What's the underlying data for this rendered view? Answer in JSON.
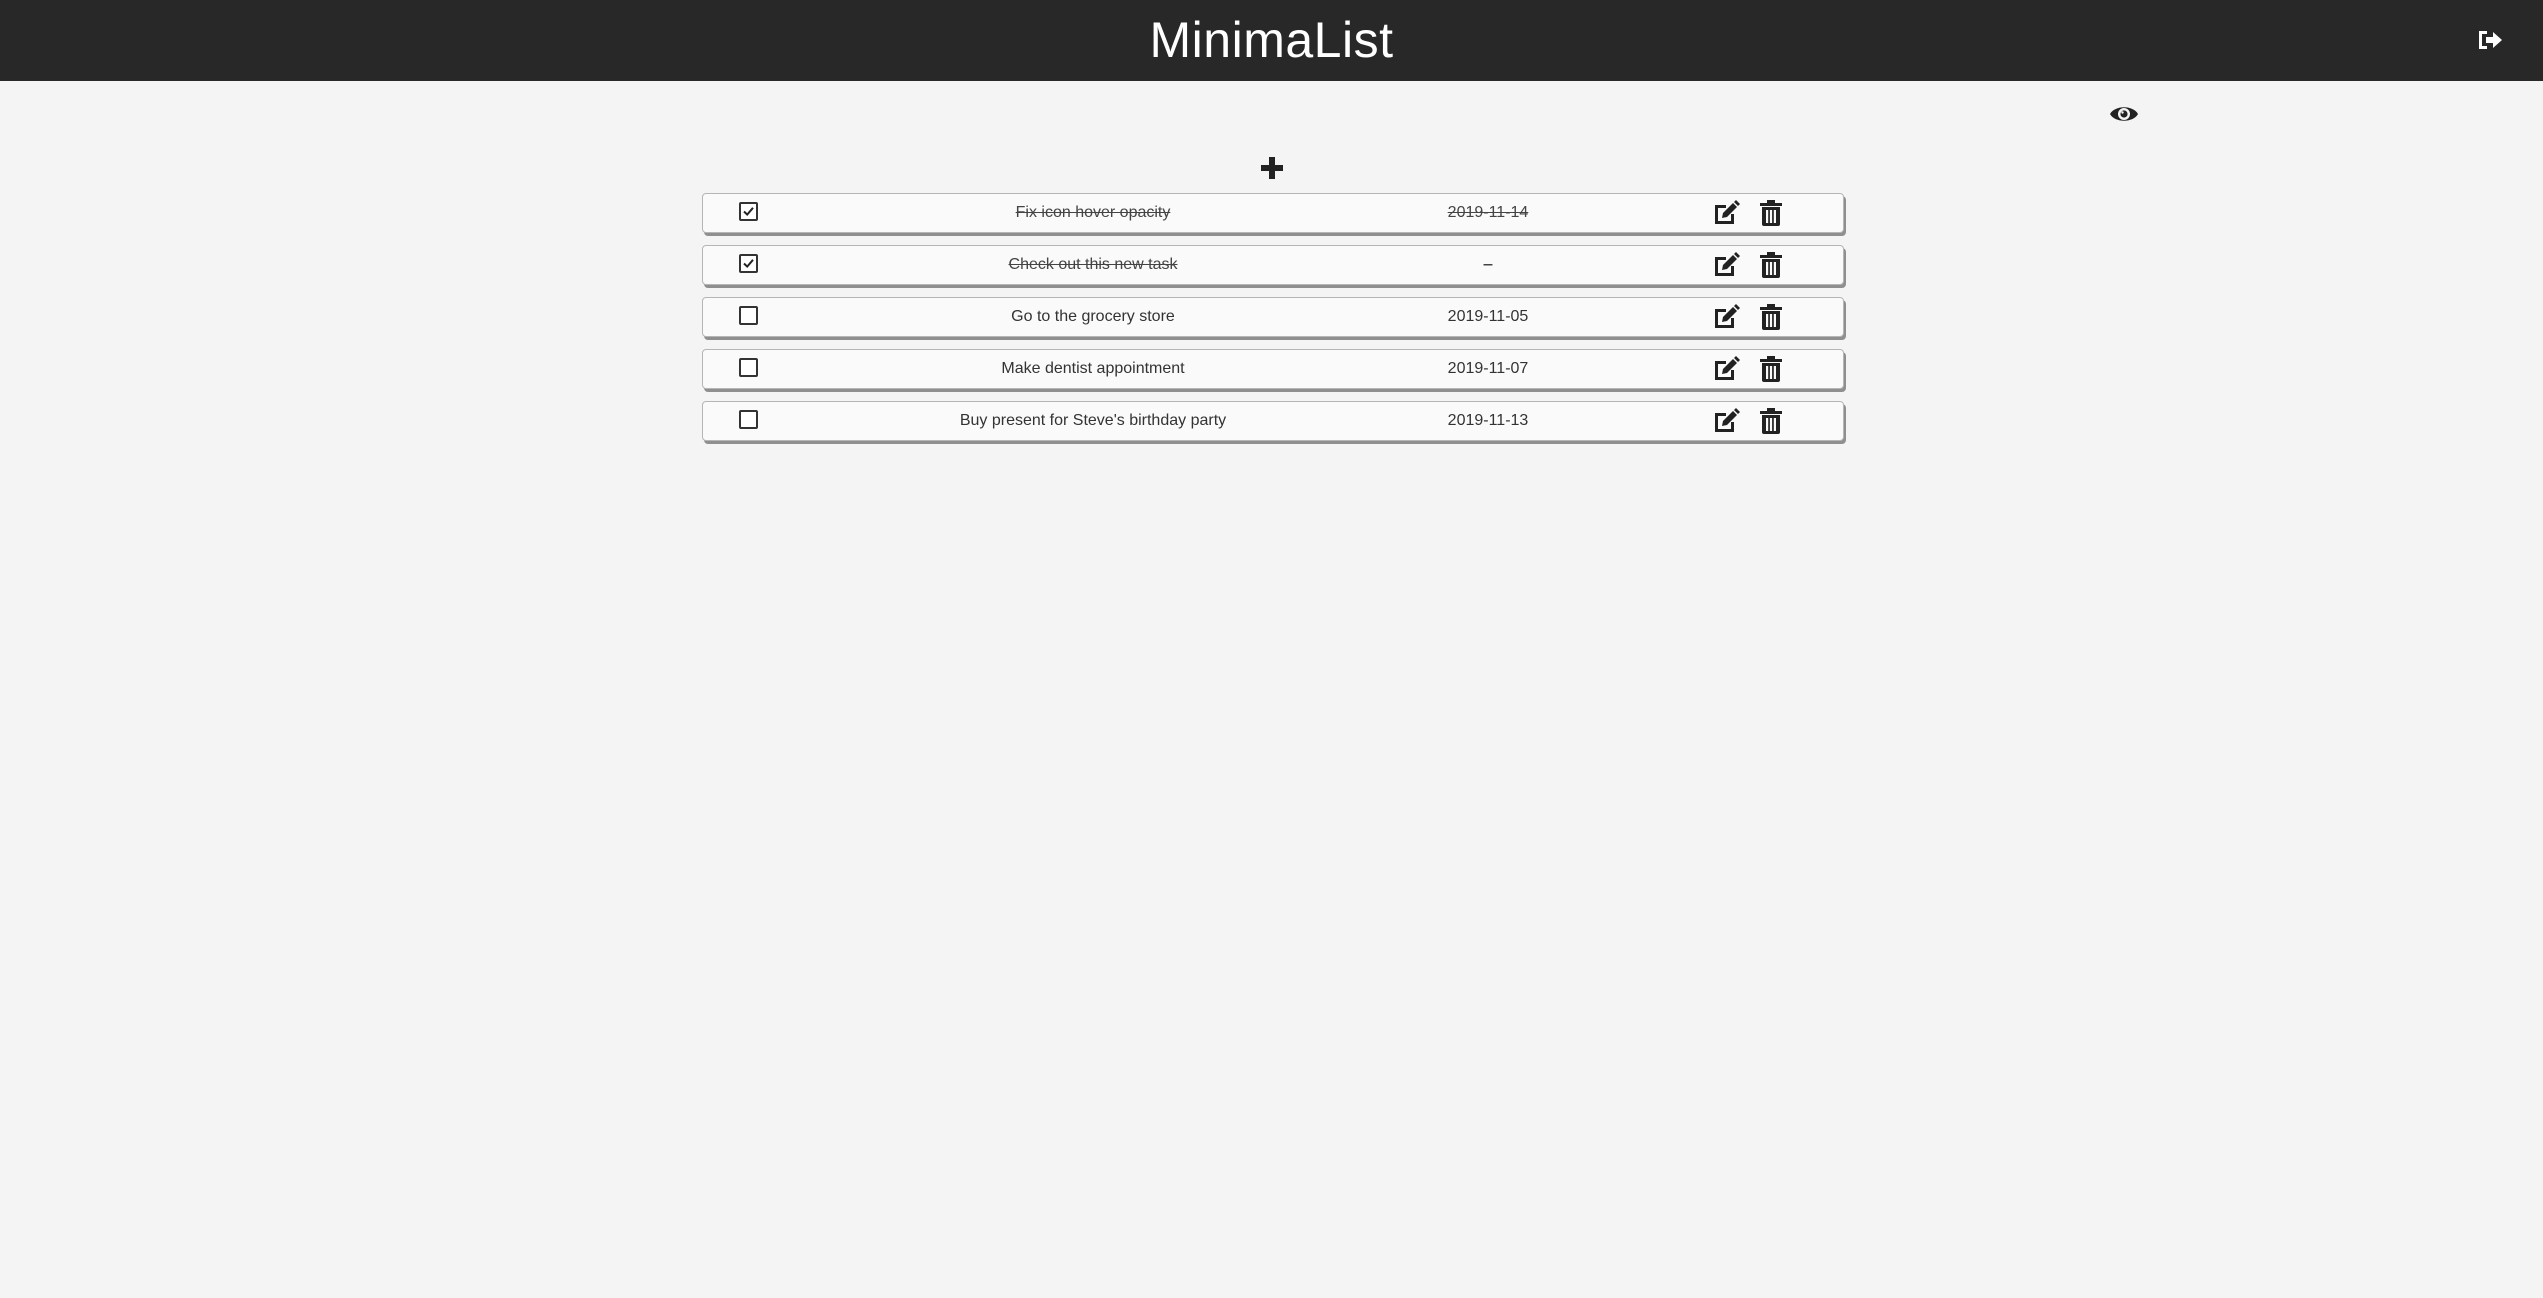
{
  "header": {
    "title": "MinimaList",
    "logout_icon": "sign-out-icon"
  },
  "toolbar": {
    "visibility_icon": "eye-icon",
    "add_icon": "plus-icon"
  },
  "tasks": [
    {
      "done": true,
      "text": "Fix icon hover opacity",
      "date": "2019-11-14"
    },
    {
      "done": true,
      "text": "Check out this new task",
      "date": "–"
    },
    {
      "done": false,
      "text": "Go to the grocery store",
      "date": "2019-11-05"
    },
    {
      "done": false,
      "text": "Make dentist appointment",
      "date": "2019-11-07"
    },
    {
      "done": false,
      "text": "Buy present for Steve's birthday party",
      "date": "2019-11-13"
    }
  ],
  "colors": {
    "header_bg": "#282828",
    "page_bg": "#f4f4f4",
    "row_bg": "#fafafa"
  }
}
